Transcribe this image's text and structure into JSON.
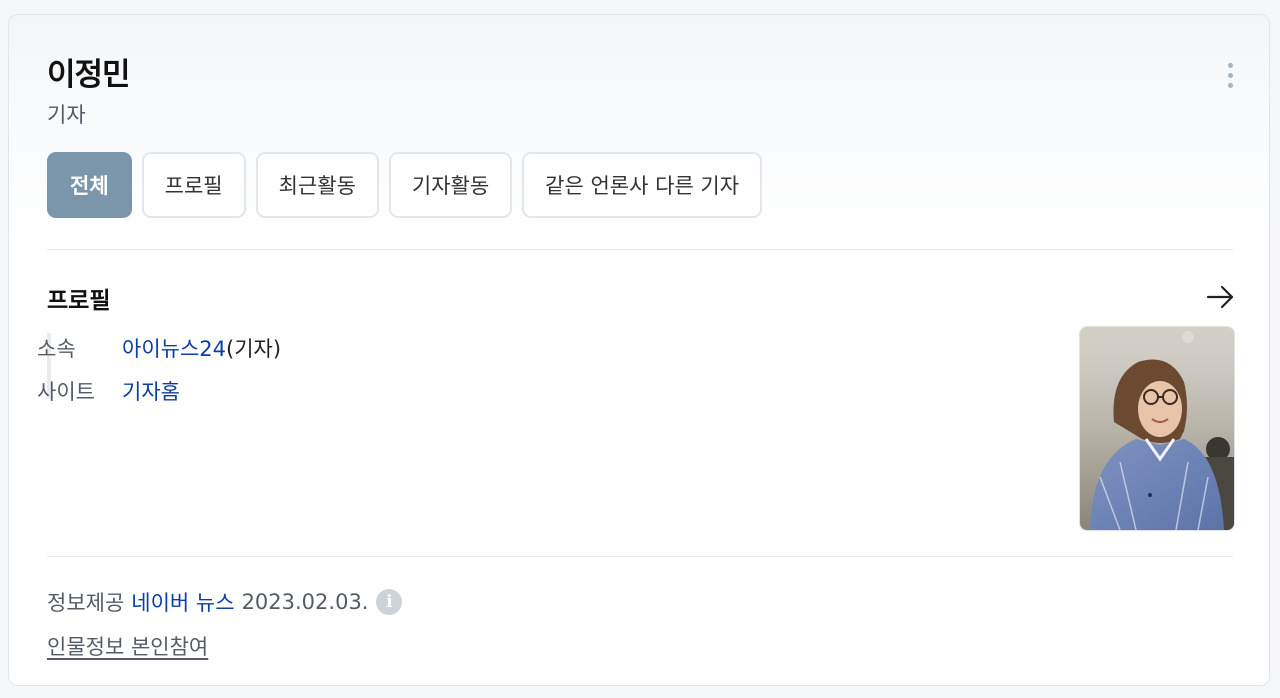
{
  "person": {
    "name": "이정민",
    "role": "기자"
  },
  "tabs": [
    {
      "label": "전체",
      "active": true
    },
    {
      "label": "프로필",
      "active": false
    },
    {
      "label": "최근활동",
      "active": false
    },
    {
      "label": "기자활동",
      "active": false
    },
    {
      "label": "같은 언론사 다른 기자",
      "active": false
    }
  ],
  "profile": {
    "title": "프로필",
    "arrow_icon": "arrow-right-icon",
    "rows": [
      {
        "label": "소속",
        "link": "아이뉴스24",
        "suffix": "(기자)"
      },
      {
        "label": "사이트",
        "link": "기자홈",
        "suffix": ""
      }
    ]
  },
  "footer": {
    "prefix": "정보제공",
    "source": "네이버 뉴스",
    "date": "2023.02.03.",
    "info_icon": "i",
    "participate": "인물정보 본인참여"
  },
  "colors": {
    "active_tab": "#7b95aa",
    "link": "#0b3ea8",
    "muted_text": "#555c66"
  }
}
